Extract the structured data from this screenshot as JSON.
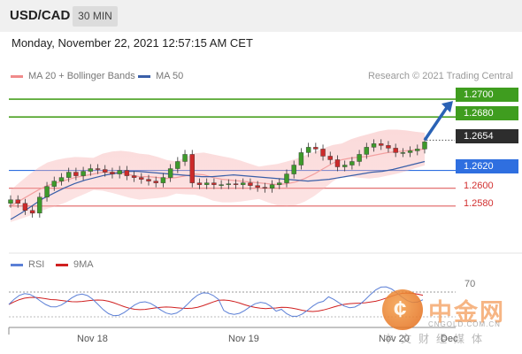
{
  "header": {
    "symbol": "USD/CAD",
    "timeframe": "30 MIN",
    "datetime": "Monday, November 22, 2021 12:57:15 AM CET"
  },
  "legend": {
    "items": [
      {
        "label": "MA 20 + Bollinger Bands",
        "color": "#f08a8a"
      },
      {
        "label": "MA 50",
        "color": "#3a5fa8"
      }
    ],
    "credit": "Research © 2021 Trading Central"
  },
  "price_levels": [
    {
      "value": "1.2700",
      "style": "green"
    },
    {
      "value": "1.2680",
      "style": "green"
    },
    {
      "value": "1.2654",
      "style": "dark"
    },
    {
      "value": "1.2620",
      "style": "blue"
    },
    {
      "value": "1.2600",
      "style": "plain"
    },
    {
      "value": "1.2580",
      "style": "plain"
    }
  ],
  "rsi": {
    "legend": [
      {
        "label": "RSI",
        "color": "#5b7fd6"
      },
      {
        "label": "9MA",
        "color": "#d02020"
      }
    ],
    "level_label": "70"
  },
  "x_axis": [
    "Nov 18",
    "Nov 19",
    "Nov 20",
    "Dec"
  ],
  "watermark": {
    "logo_glyph": "¢",
    "name": "中金网",
    "url": "CNGOLD.COM.CN",
    "subtitle": "中文财经媒体"
  },
  "chart_data": {
    "type": "line",
    "title": "USD/CAD 30 MIN",
    "ylim": [
      1.2545,
      1.2712
    ],
    "levels": [
      1.27,
      1.268,
      1.2654,
      1.262,
      1.26,
      1.258
    ],
    "series": [
      {
        "name": "Price",
        "values": [
          1.2587,
          1.2583,
          1.2575,
          1.2572,
          1.259,
          1.2602,
          1.2608,
          1.2612,
          1.2618,
          1.2614,
          1.2619,
          1.2622,
          1.2621,
          1.2618,
          1.2616,
          1.262,
          1.2614,
          1.2612,
          1.261,
          1.2608,
          1.2606,
          1.2612,
          1.2622,
          1.263,
          1.2638,
          1.2606,
          1.2604,
          1.2606,
          1.2604,
          1.2604,
          1.2605,
          1.2604,
          1.2606,
          1.2603,
          1.2601,
          1.26,
          1.2604,
          1.2606,
          1.2616,
          1.2626,
          1.264,
          1.2646,
          1.2644,
          1.2636,
          1.2632,
          1.2624,
          1.2626,
          1.263,
          1.2638,
          1.2646,
          1.265,
          1.2648,
          1.2645,
          1.264,
          1.264,
          1.2642,
          1.2644,
          1.2652
        ]
      },
      {
        "name": "MA 20",
        "values": [
          1.258,
          1.2586,
          1.2592,
          1.2598,
          1.2603,
          1.2606,
          1.2609,
          1.2612,
          1.2614,
          1.2616,
          1.2618,
          1.2618,
          1.2617,
          1.2615,
          1.2613,
          1.2613,
          1.2612,
          1.2611,
          1.2612,
          1.2614,
          1.2616,
          1.2615,
          1.2612,
          1.261,
          1.2609,
          1.2608,
          1.2607,
          1.2606,
          1.2605,
          1.2604,
          1.2605,
          1.2607,
          1.2611,
          1.2616,
          1.2622,
          1.2628,
          1.2632,
          1.2634,
          1.2635,
          1.2636,
          1.2638,
          1.264,
          1.2641,
          1.2642,
          1.2643,
          1.2644
        ]
      },
      {
        "name": "MA 50",
        "values": [
          1.2565,
          1.2572,
          1.258,
          1.2588,
          1.2594,
          1.26,
          1.2605,
          1.2609,
          1.2612,
          1.2615,
          1.2617,
          1.2619,
          1.2619,
          1.2618,
          1.2617,
          1.2616,
          1.2615,
          1.2614,
          1.2613,
          1.2613,
          1.2614,
          1.2615,
          1.2614,
          1.2613,
          1.2612,
          1.2611,
          1.261,
          1.2609,
          1.2608,
          1.2609,
          1.261,
          1.2612,
          1.2614,
          1.2616,
          1.2618,
          1.2619,
          1.2621,
          1.2624,
          1.2627,
          1.263
        ]
      }
    ],
    "projection": {
      "from": 1.2654,
      "to": 1.27
    }
  }
}
